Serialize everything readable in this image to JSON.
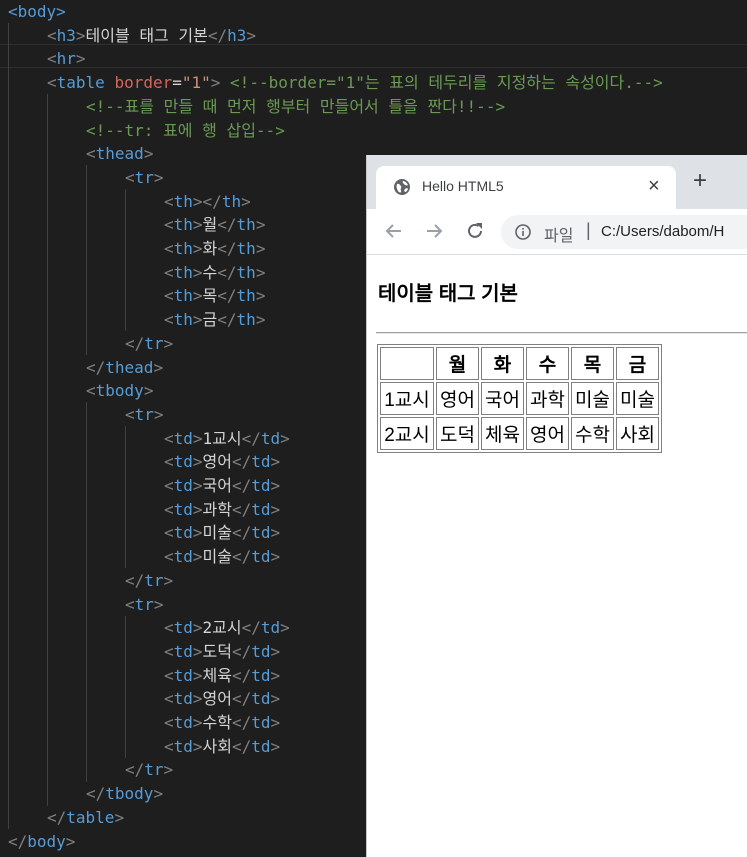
{
  "editor": {
    "code_lines": [
      {
        "indent": 0,
        "tokens": [
          [
            "tag",
            "<body>"
          ]
        ]
      },
      {
        "indent": 1,
        "tokens": [
          [
            "br",
            "<"
          ],
          [
            "tag",
            "h3"
          ],
          [
            "br",
            ">"
          ],
          [
            "txt",
            "테이블 태그 기본"
          ],
          [
            "br",
            "</"
          ],
          [
            "tag",
            "h3"
          ],
          [
            "br",
            ">"
          ]
        ]
      },
      {
        "indent": 1,
        "tokens": [
          [
            "br",
            "<"
          ],
          [
            "tag",
            "hr"
          ],
          [
            "br",
            ">"
          ]
        ]
      },
      {
        "indent": 1,
        "tokens": [
          [
            "br",
            "<"
          ],
          [
            "tag",
            "table "
          ],
          [
            "attr2",
            "border"
          ],
          [
            "txt",
            "="
          ],
          [
            "str",
            "\"1\""
          ],
          [
            "br",
            "> "
          ],
          [
            "cmt",
            "<!--border=\"1\"는 표의 테두리를 지정하는 속성이다.-->"
          ]
        ]
      },
      {
        "indent": 2,
        "tokens": [
          [
            "cmt",
            "<!--표를 만들 때 먼저 행부터 만들어서 틀을 짠다!!-->"
          ]
        ]
      },
      {
        "indent": 2,
        "tokens": [
          [
            "cmt",
            "<!--tr: 표에 행 삽입-->"
          ]
        ]
      },
      {
        "indent": 2,
        "tokens": [
          [
            "br",
            "<"
          ],
          [
            "tag",
            "thead"
          ],
          [
            "br",
            ">"
          ]
        ]
      },
      {
        "indent": 3,
        "tokens": [
          [
            "br",
            "<"
          ],
          [
            "tag",
            "tr"
          ],
          [
            "br",
            ">"
          ]
        ]
      },
      {
        "indent": 4,
        "tokens": [
          [
            "br",
            "<"
          ],
          [
            "tag",
            "th"
          ],
          [
            "br",
            "></"
          ],
          [
            "tag",
            "th"
          ],
          [
            "br",
            ">"
          ]
        ]
      },
      {
        "indent": 4,
        "tokens": [
          [
            "br",
            "<"
          ],
          [
            "tag",
            "th"
          ],
          [
            "br",
            ">"
          ],
          [
            "txt",
            "월"
          ],
          [
            "br",
            "</"
          ],
          [
            "tag",
            "th"
          ],
          [
            "br",
            ">"
          ]
        ]
      },
      {
        "indent": 4,
        "tokens": [
          [
            "br",
            "<"
          ],
          [
            "tag",
            "th"
          ],
          [
            "br",
            ">"
          ],
          [
            "txt",
            "화"
          ],
          [
            "br",
            "</"
          ],
          [
            "tag",
            "th"
          ],
          [
            "br",
            ">"
          ]
        ]
      },
      {
        "indent": 4,
        "tokens": [
          [
            "br",
            "<"
          ],
          [
            "tag",
            "th"
          ],
          [
            "br",
            ">"
          ],
          [
            "txt",
            "수"
          ],
          [
            "br",
            "</"
          ],
          [
            "tag",
            "th"
          ],
          [
            "br",
            ">"
          ]
        ]
      },
      {
        "indent": 4,
        "tokens": [
          [
            "br",
            "<"
          ],
          [
            "tag",
            "th"
          ],
          [
            "br",
            ">"
          ],
          [
            "txt",
            "목"
          ],
          [
            "br",
            "</"
          ],
          [
            "tag",
            "th"
          ],
          [
            "br",
            ">"
          ]
        ]
      },
      {
        "indent": 4,
        "tokens": [
          [
            "br",
            "<"
          ],
          [
            "tag",
            "th"
          ],
          [
            "br",
            ">"
          ],
          [
            "txt",
            "금"
          ],
          [
            "br",
            "</"
          ],
          [
            "tag",
            "th"
          ],
          [
            "br",
            ">"
          ]
        ]
      },
      {
        "indent": 3,
        "tokens": [
          [
            "br",
            "</"
          ],
          [
            "tag",
            "tr"
          ],
          [
            "br",
            ">"
          ]
        ]
      },
      {
        "indent": 2,
        "tokens": [
          [
            "br",
            "</"
          ],
          [
            "tag",
            "thead"
          ],
          [
            "br",
            ">"
          ]
        ]
      },
      {
        "indent": 2,
        "tokens": [
          [
            "br",
            "<"
          ],
          [
            "tag",
            "tbody"
          ],
          [
            "br",
            ">"
          ]
        ]
      },
      {
        "indent": 3,
        "tokens": [
          [
            "br",
            "<"
          ],
          [
            "tag",
            "tr"
          ],
          [
            "br",
            ">"
          ]
        ]
      },
      {
        "indent": 4,
        "tokens": [
          [
            "br",
            "<"
          ],
          [
            "tag",
            "td"
          ],
          [
            "br",
            ">"
          ],
          [
            "txt",
            "1교시"
          ],
          [
            "br",
            "</"
          ],
          [
            "tag",
            "td"
          ],
          [
            "br",
            ">"
          ]
        ]
      },
      {
        "indent": 4,
        "tokens": [
          [
            "br",
            "<"
          ],
          [
            "tag",
            "td"
          ],
          [
            "br",
            ">"
          ],
          [
            "txt",
            "영어"
          ],
          [
            "br",
            "</"
          ],
          [
            "tag",
            "td"
          ],
          [
            "br",
            ">"
          ]
        ]
      },
      {
        "indent": 4,
        "tokens": [
          [
            "br",
            "<"
          ],
          [
            "tag",
            "td"
          ],
          [
            "br",
            ">"
          ],
          [
            "txt",
            "국어"
          ],
          [
            "br",
            "</"
          ],
          [
            "tag",
            "td"
          ],
          [
            "br",
            ">"
          ]
        ]
      },
      {
        "indent": 4,
        "tokens": [
          [
            "br",
            "<"
          ],
          [
            "tag",
            "td"
          ],
          [
            "br",
            ">"
          ],
          [
            "txt",
            "과학"
          ],
          [
            "br",
            "</"
          ],
          [
            "tag",
            "td"
          ],
          [
            "br",
            ">"
          ]
        ]
      },
      {
        "indent": 4,
        "tokens": [
          [
            "br",
            "<"
          ],
          [
            "tag",
            "td"
          ],
          [
            "br",
            ">"
          ],
          [
            "txt",
            "미술"
          ],
          [
            "br",
            "</"
          ],
          [
            "tag",
            "td"
          ],
          [
            "br",
            ">"
          ]
        ]
      },
      {
        "indent": 4,
        "tokens": [
          [
            "br",
            "<"
          ],
          [
            "tag",
            "td"
          ],
          [
            "br",
            ">"
          ],
          [
            "txt",
            "미술"
          ],
          [
            "br",
            "</"
          ],
          [
            "tag",
            "td"
          ],
          [
            "br",
            ">"
          ]
        ]
      },
      {
        "indent": 3,
        "tokens": [
          [
            "br",
            "</"
          ],
          [
            "tag",
            "tr"
          ],
          [
            "br",
            ">"
          ]
        ]
      },
      {
        "indent": 3,
        "tokens": [
          [
            "br",
            "<"
          ],
          [
            "tag",
            "tr"
          ],
          [
            "br",
            ">"
          ]
        ]
      },
      {
        "indent": 4,
        "tokens": [
          [
            "br",
            "<"
          ],
          [
            "tag",
            "td"
          ],
          [
            "br",
            ">"
          ],
          [
            "txt",
            "2교시"
          ],
          [
            "br",
            "</"
          ],
          [
            "tag",
            "td"
          ],
          [
            "br",
            ">"
          ]
        ]
      },
      {
        "indent": 4,
        "tokens": [
          [
            "br",
            "<"
          ],
          [
            "tag",
            "td"
          ],
          [
            "br",
            ">"
          ],
          [
            "txt",
            "도덕"
          ],
          [
            "br",
            "</"
          ],
          [
            "tag",
            "td"
          ],
          [
            "br",
            ">"
          ]
        ]
      },
      {
        "indent": 4,
        "tokens": [
          [
            "br",
            "<"
          ],
          [
            "tag",
            "td"
          ],
          [
            "br",
            ">"
          ],
          [
            "txt",
            "체육"
          ],
          [
            "br",
            "</"
          ],
          [
            "tag",
            "td"
          ],
          [
            "br",
            ">"
          ]
        ]
      },
      {
        "indent": 4,
        "tokens": [
          [
            "br",
            "<"
          ],
          [
            "tag",
            "td"
          ],
          [
            "br",
            ">"
          ],
          [
            "txt",
            "영어"
          ],
          [
            "br",
            "</"
          ],
          [
            "tag",
            "td"
          ],
          [
            "br",
            ">"
          ]
        ]
      },
      {
        "indent": 4,
        "tokens": [
          [
            "br",
            "<"
          ],
          [
            "tag",
            "td"
          ],
          [
            "br",
            ">"
          ],
          [
            "txt",
            "수학"
          ],
          [
            "br",
            "</"
          ],
          [
            "tag",
            "td"
          ],
          [
            "br",
            ">"
          ]
        ]
      },
      {
        "indent": 4,
        "tokens": [
          [
            "br",
            "<"
          ],
          [
            "tag",
            "td"
          ],
          [
            "br",
            ">"
          ],
          [
            "txt",
            "사회"
          ],
          [
            "br",
            "</"
          ],
          [
            "tag",
            "td"
          ],
          [
            "br",
            ">"
          ]
        ]
      },
      {
        "indent": 3,
        "tokens": [
          [
            "br",
            "</"
          ],
          [
            "tag",
            "tr"
          ],
          [
            "br",
            ">"
          ]
        ]
      },
      {
        "indent": 2,
        "tokens": [
          [
            "br",
            "</"
          ],
          [
            "tag",
            "tbody"
          ],
          [
            "br",
            ">"
          ]
        ]
      },
      {
        "indent": 1,
        "tokens": [
          [
            "br",
            "</"
          ],
          [
            "tag",
            "table"
          ],
          [
            "br",
            ">"
          ]
        ]
      },
      {
        "indent": 0,
        "tokens": [
          [
            "br",
            "</"
          ],
          [
            "tag",
            "body"
          ],
          [
            "br",
            ">"
          ]
        ]
      }
    ]
  },
  "browser": {
    "tab_title": "Hello HTML5",
    "tab_close": "×",
    "new_tab": "+",
    "scheme_label": "파일",
    "separator": "|",
    "url": "C:/Users/dabom/H",
    "page": {
      "heading": "테이블 태그 기본",
      "table": {
        "headers": [
          "",
          "월",
          "화",
          "수",
          "목",
          "금"
        ],
        "rows": [
          [
            "1교시",
            "영어",
            "국어",
            "과학",
            "미술",
            "미술"
          ],
          [
            "2교시",
            "도덕",
            "체육",
            "영어",
            "수학",
            "사회"
          ]
        ]
      }
    }
  }
}
